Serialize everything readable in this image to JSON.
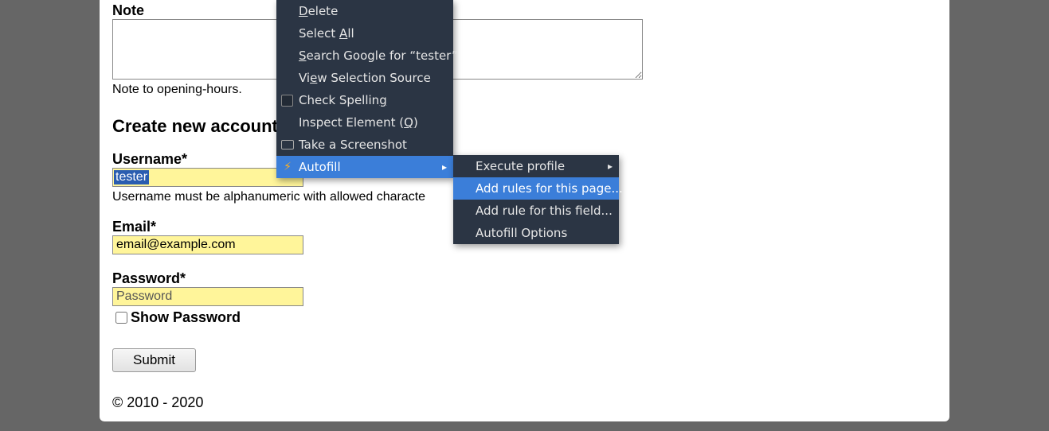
{
  "note": {
    "label": "Note",
    "value": "",
    "hint": "Note to opening-hours."
  },
  "create_account": {
    "heading": "Create new account",
    "username": {
      "label": "Username",
      "required": "*",
      "value": "tester",
      "hint": "Username must be alphanumeric with allowed characte"
    },
    "email": {
      "label": "Email",
      "required": "*",
      "value": "email@example.com"
    },
    "password": {
      "label": "Password",
      "required": "*",
      "placeholder": "Password",
      "value": ""
    },
    "show_password_label": "Show Password",
    "submit_label": "Submit"
  },
  "footer": "© 2010 - 2020",
  "context_menu": {
    "items": {
      "delete": {
        "pre": "",
        "u": "D",
        "post": "elete"
      },
      "select_all": {
        "pre": "Select ",
        "u": "A",
        "post": "ll"
      },
      "search": {
        "pre": "",
        "u": "S",
        "post": "earch Google for “tester”"
      },
      "view_source": {
        "pre": "Vi",
        "u": "e",
        "post": "w Selection Source"
      },
      "check_spelling": {
        "pre": "Check Spellin",
        "u": "g",
        "post": ""
      },
      "inspect": {
        "pre": "Inspect Element (",
        "u": "Q",
        "post": ")"
      },
      "screenshot": "Take a Screenshot",
      "autofill": "Autofill"
    }
  },
  "submenu": {
    "execute_profile": "Execute profile",
    "add_rules_page": "Add rules for this page...",
    "add_rule_field": "Add rule for this field...",
    "autofill_options": "Autofill Options"
  }
}
